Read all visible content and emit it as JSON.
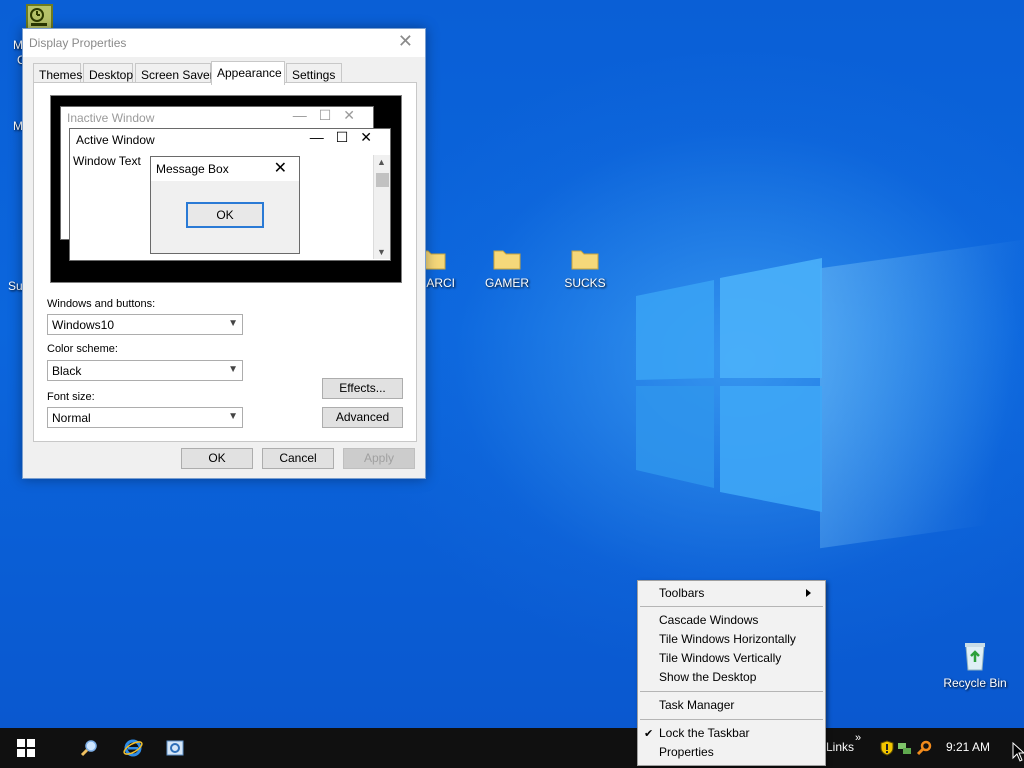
{
  "desktop": {
    "icons": [
      {
        "label": "ARCI"
      },
      {
        "label": "GAMER"
      },
      {
        "label": "SUCKS"
      },
      {
        "label": "Recycle Bin"
      }
    ],
    "edge_labels": [
      "M",
      "C",
      "M",
      "Su"
    ]
  },
  "dialog": {
    "title": "Display Properties",
    "tabs": [
      "Themes",
      "Desktop",
      "Screen Saver",
      "Appearance",
      "Settings"
    ],
    "active_tab": "Appearance",
    "preview": {
      "inactive_title": "Inactive Window",
      "active_title": "Active Window",
      "window_text": "Window Text",
      "message_box_title": "Message Box",
      "ok_label": "OK"
    },
    "windows_buttons_label": "Windows and buttons:",
    "windows_buttons_value": "Windows10",
    "color_scheme_label": "Color scheme:",
    "color_scheme_value": "Black",
    "font_size_label": "Font size:",
    "font_size_value": "Normal",
    "effects_label": "Effects...",
    "advanced_label": "Advanced",
    "ok_label": "OK",
    "cancel_label": "Cancel",
    "apply_label": "Apply"
  },
  "context_menu": {
    "toolbars": "Toolbars",
    "cascade": "Cascade Windows",
    "tile_h": "Tile Windows Horizontally",
    "tile_v": "Tile Windows Vertically",
    "show_desktop": "Show the Desktop",
    "task_manager": "Task Manager",
    "lock_taskbar": "Lock the Taskbar",
    "lock_taskbar_checked": true,
    "properties": "Properties"
  },
  "taskbar": {
    "links_label": "Links",
    "links_chevron": "»",
    "clock": "9:21 AM",
    "icons": [
      "start-icon",
      "search-icon",
      "internet-explorer-icon",
      "control-panel-icon"
    ],
    "tray_icons": [
      "security-shield-icon",
      "network-icon",
      "search-tray-icon"
    ]
  },
  "colors": {
    "wallpaper": "#0b66dd",
    "taskbar": "#101010",
    "folder": "#f5d87a",
    "focus_blue": "#2a7ad5"
  }
}
